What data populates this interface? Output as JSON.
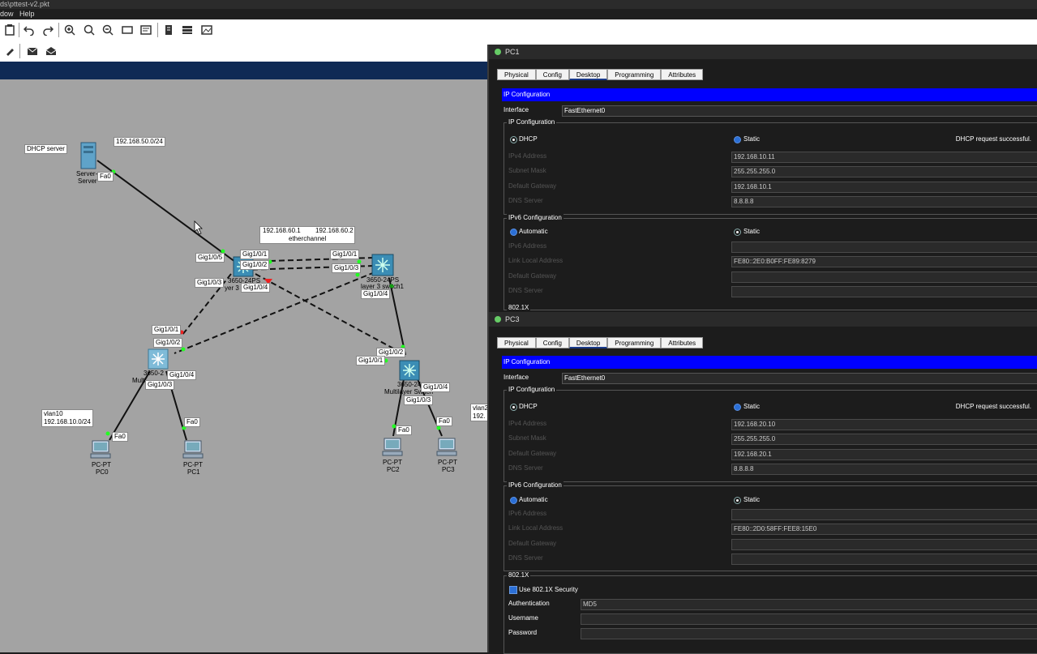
{
  "window": {
    "title": "ds\\pttest-v2.pkt"
  },
  "menu": {
    "items": [
      "dow",
      "Help"
    ]
  },
  "toolbar": {
    "icons": [
      "notes-icon",
      "undo-icon",
      "redo-icon",
      "zoom-in-icon",
      "zoom-reset-icon",
      "zoom-out-icon",
      "rectangle-icon",
      "palette-icon",
      "document-icon",
      "device-list-icon",
      "image-icon"
    ]
  },
  "toolbar2": {
    "icons": [
      "pencil-icon",
      "simple-pdu-icon",
      "complex-pdu-icon"
    ]
  },
  "topology": {
    "dhcp_label": "DHCP server",
    "server_subnet": "192.168.50.0/24",
    "server_name_a": "Server-",
    "server_name_b": "Server",
    "server_port": "Fa0",
    "etherchannel": {
      "ip1": "192.168.60.1",
      "ip2": "192.168.60.2",
      "name": "etherchannel"
    },
    "core_ports": {
      "p5": "Gig1/0/5",
      "p1": "Gig1/0/1",
      "p2": "Gig1/0/2",
      "p3": "Gig1/0/3",
      "p4": "Gig1/0/4"
    },
    "core_name_a": "3650-24PS",
    "core_name_b": "yer 3",
    "sw1_ports": {
      "p1": "Gig1/0/1",
      "p3": "Gig1/0/3",
      "p4": "Gig1/0/4"
    },
    "sw1_name_a": "3650-24PS",
    "sw1_name_b": "layer 3 switch1",
    "left_ports": {
      "p1": "Gig1/0/1",
      "p2": "Gig1/0/2",
      "p3": "Gig1/0/3",
      "p4": "Gig1/0/4"
    },
    "left_name_a": "3650-2",
    "left_name_b": "Multi",
    "right_ports": {
      "p2": "Gig1/0/2",
      "p1": "Gig1/0/1",
      "p4": "Gig1/0/4",
      "p3": "Gig1/0/3"
    },
    "right_name_a": "3650-24",
    "right_name_b": "Multilayer Switch",
    "vlan10": {
      "line1": "vlan10",
      "line2": "192.168.10.0/24"
    },
    "vlan20": {
      "line1": "vlan2",
      "line2": "192."
    },
    "pcs": [
      {
        "type": "PC-PT",
        "name": "PC0",
        "port": "Fa0"
      },
      {
        "type": "PC-PT",
        "name": "PC1",
        "port": "Fa0"
      },
      {
        "type": "PC-PT",
        "name": "PC2",
        "port": "Fa0"
      },
      {
        "type": "PC-PT",
        "name": "PC3",
        "port": "Fa0"
      }
    ]
  },
  "pc1": {
    "title": "PC1",
    "tabs": [
      "Physical",
      "Config",
      "Desktop",
      "Programming",
      "Attributes"
    ],
    "active_tab": "Desktop",
    "header": "IP Configuration",
    "interface_label": "Interface",
    "interface_value": "FastEthernet0",
    "ipv4_group": "IP Configuration",
    "dhcp": "DHCP",
    "static": "Static",
    "status": "DHCP request successful.",
    "ipv4_labels": [
      "IPv4 Address",
      "Subnet Mask",
      "Default Gateway",
      "DNS Server"
    ],
    "ipv4_values": [
      "192.168.10.11",
      "255.255.255.0",
      "192.168.10.1",
      "8.8.8.8"
    ],
    "ipv6_group": "IPv6 Configuration",
    "automatic": "Automatic",
    "ipv6_static": "Static",
    "ipv6_labels": [
      "IPv6 Address",
      "Link Local Address",
      "Default Gateway",
      "DNS Server"
    ],
    "ipv6_values": [
      "",
      "FE80::2E0:B0FF:FE89:8279",
      "",
      ""
    ],
    "dot1x_group": "802.1X"
  },
  "pc3": {
    "title": "PC3",
    "tabs": [
      "Physical",
      "Config",
      "Desktop",
      "Programming",
      "Attributes"
    ],
    "active_tab": "Desktop",
    "header": "IP Configuration",
    "interface_label": "Interface",
    "interface_value": "FastEthernet0",
    "ipv4_group": "IP Configuration",
    "dhcp": "DHCP",
    "static": "Static",
    "status": "DHCP request successful.",
    "ipv4_labels": [
      "IPv4 Address",
      "Subnet Mask",
      "Default Gateway",
      "DNS Server"
    ],
    "ipv4_values": [
      "192.168.20.10",
      "255.255.255.0",
      "192.168.20.1",
      "8.8.8.8"
    ],
    "ipv6_group": "IPv6 Configuration",
    "automatic": "Automatic",
    "ipv6_static": "Static",
    "ipv6_labels": [
      "IPv6 Address",
      "Link Local Address",
      "Default Gateway",
      "DNS Server"
    ],
    "ipv6_values": [
      "",
      "FE80::2D0:58FF:FEE8:15E0",
      "",
      ""
    ],
    "dot1x_group": "802.1X",
    "use_8021x": "Use 802.1X Security",
    "auth_label": "Authentication",
    "auth_value": "MD5",
    "username_label": "Username",
    "password_label": "Password"
  },
  "colors": {
    "accent_blue": "#0000ff",
    "dialog_bg": "#1c1c1c",
    "canvas_bg": "#a3a3a3",
    "toolbar_strip": "#0f2a55"
  }
}
